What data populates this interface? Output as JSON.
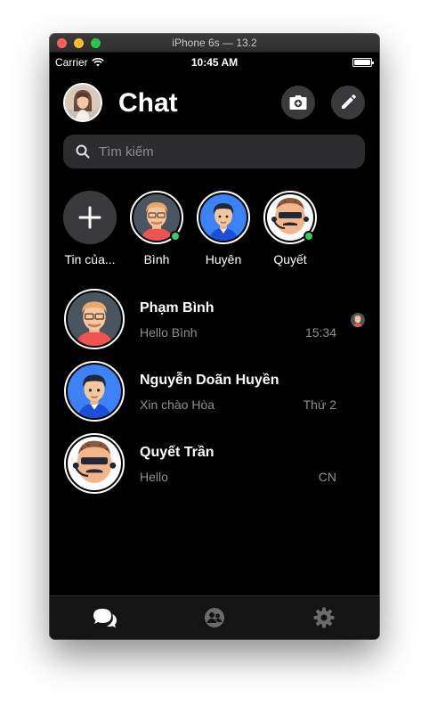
{
  "window": {
    "title": "iPhone 6s — 13.2"
  },
  "status_bar": {
    "carrier": "Carrier",
    "time": "10:45 AM"
  },
  "header": {
    "title": "Chat"
  },
  "search": {
    "placeholder": "Tìm kiếm"
  },
  "stories": [
    {
      "label": "Tin của...",
      "kind": "add",
      "icon": "plus-icon"
    },
    {
      "label": "Bình",
      "avatar": "avatar-binh",
      "online": true
    },
    {
      "label": "Huyên",
      "avatar": "avatar-huyen",
      "online": false
    },
    {
      "label": "Quyết",
      "avatar": "avatar-quyet",
      "online": true
    }
  ],
  "conversations": [
    {
      "name": "Phạm Bình",
      "message": "Hello Bình",
      "time": "15:34",
      "avatar": "avatar-binh",
      "seen": true
    },
    {
      "name": "Nguyễn Doãn Huyền",
      "message": "Xin chào Hòa",
      "time": "Thứ 2",
      "avatar": "avatar-huyen",
      "seen": false
    },
    {
      "name": "Quyết Trần",
      "message": "Hello",
      "time": "CN",
      "avatar": "avatar-quyet",
      "seen": false
    }
  ],
  "tabs": [
    {
      "name": "chats",
      "icon": "chat-bubbles-icon",
      "active": true
    },
    {
      "name": "people",
      "icon": "people-icon",
      "active": false
    },
    {
      "name": "settings",
      "icon": "gear-icon",
      "active": false
    }
  ],
  "colors": {
    "background": "#000000",
    "surface": "#2c2c2e",
    "button": "#3a3a3c",
    "secondary_text": "#8e8e93",
    "online": "#31d158",
    "avatar_blue": "#3b82f6",
    "avatar_gray": "#4a5560"
  }
}
